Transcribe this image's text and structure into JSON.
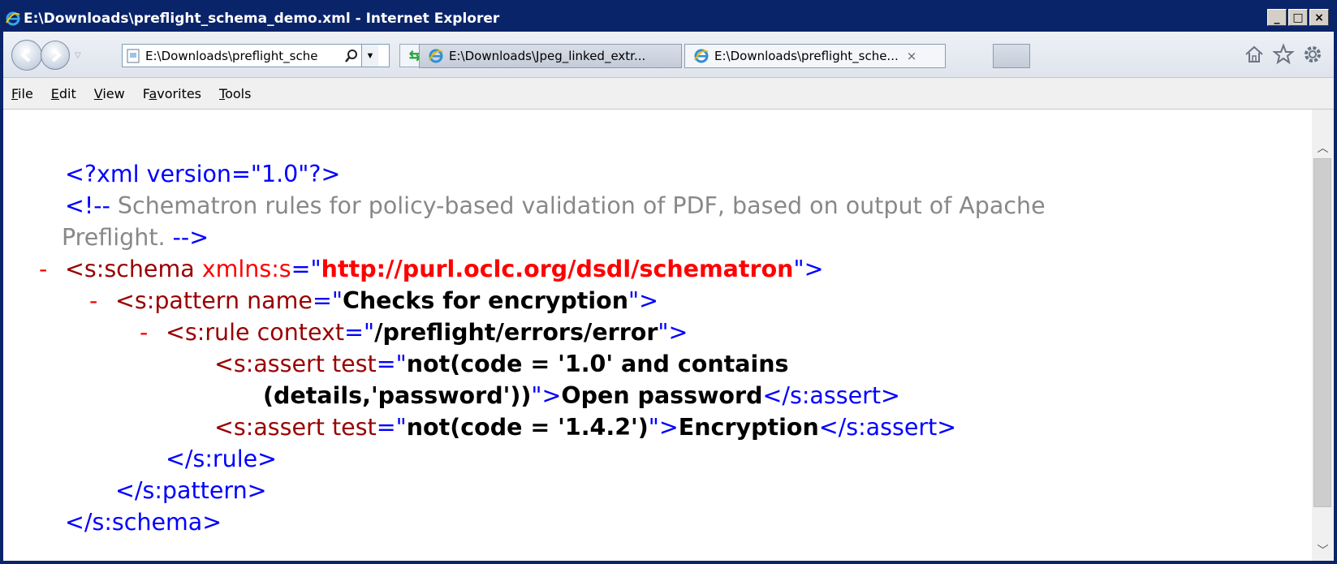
{
  "window": {
    "title": "E:\\Downloads\\preflight_schema_demo.xml - Internet Explorer",
    "min_label": "_",
    "max_label": "□",
    "close_label": "×"
  },
  "nav": {
    "address": "E:\\Downloads\\preflight_sche",
    "tabs": [
      {
        "label": "E:\\Downloads\\Jpeg_linked_extr...",
        "active": false
      },
      {
        "label": "E:\\Downloads\\preflight_sche...",
        "active": true
      }
    ],
    "tab_close": "×",
    "icons": [
      "back-icon",
      "forward-icon",
      "page-icon",
      "search-icon",
      "compatibility-icon",
      "ie-icon",
      "home-icon",
      "favorites-star-icon",
      "gear-icon"
    ]
  },
  "menu": {
    "items": [
      {
        "label_pre": "",
        "ul": "F",
        "label_post": "ile"
      },
      {
        "label_pre": "",
        "ul": "E",
        "label_post": "dit"
      },
      {
        "label_pre": "",
        "ul": "V",
        "label_post": "iew"
      },
      {
        "label_pre": "F",
        "ul": "a",
        "label_post": "vorites"
      },
      {
        "label_pre": "",
        "ul": "T",
        "label_post": "ools"
      }
    ]
  },
  "xml": {
    "decl": "<?xml version=\"1.0\"?>",
    "comment_open": "<!--",
    "comment_text_1": " Schematron rules for policy-based validation of PDF, based on output of Apache",
    "comment_text_2": "Preflight.",
    "comment_close": " -->",
    "collapse": "-",
    "schema_open_tag": "<s:schema",
    "schema_attr": " xmlns:s",
    "eq_quote": "=\"",
    "schema_attr_val": "http://purl.oclc.org/dsdl/schematron",
    "quote_gt": "\">",
    "pattern_open_tag": "<s:pattern",
    "pattern_attr": " name",
    "pattern_attr_val": "Checks for encryption",
    "rule_open_tag": "<s:rule",
    "rule_attr": " context",
    "rule_attr_val": "/preflight/errors/error",
    "assert_open_tag": "<s:assert",
    "assert_attr": " test",
    "assert1_val_1": "not(code = '1.0' and contains",
    "assert1_val_2": "(details,'password'))",
    "assert1_text": "Open password",
    "assert_close": "</s:assert>",
    "assert2_val": "not(code = '1.4.2')",
    "assert2_text": "Encryption",
    "rule_close": "</s:rule>",
    "pattern_close": "</s:pattern>",
    "schema_close": "</s:schema>"
  }
}
